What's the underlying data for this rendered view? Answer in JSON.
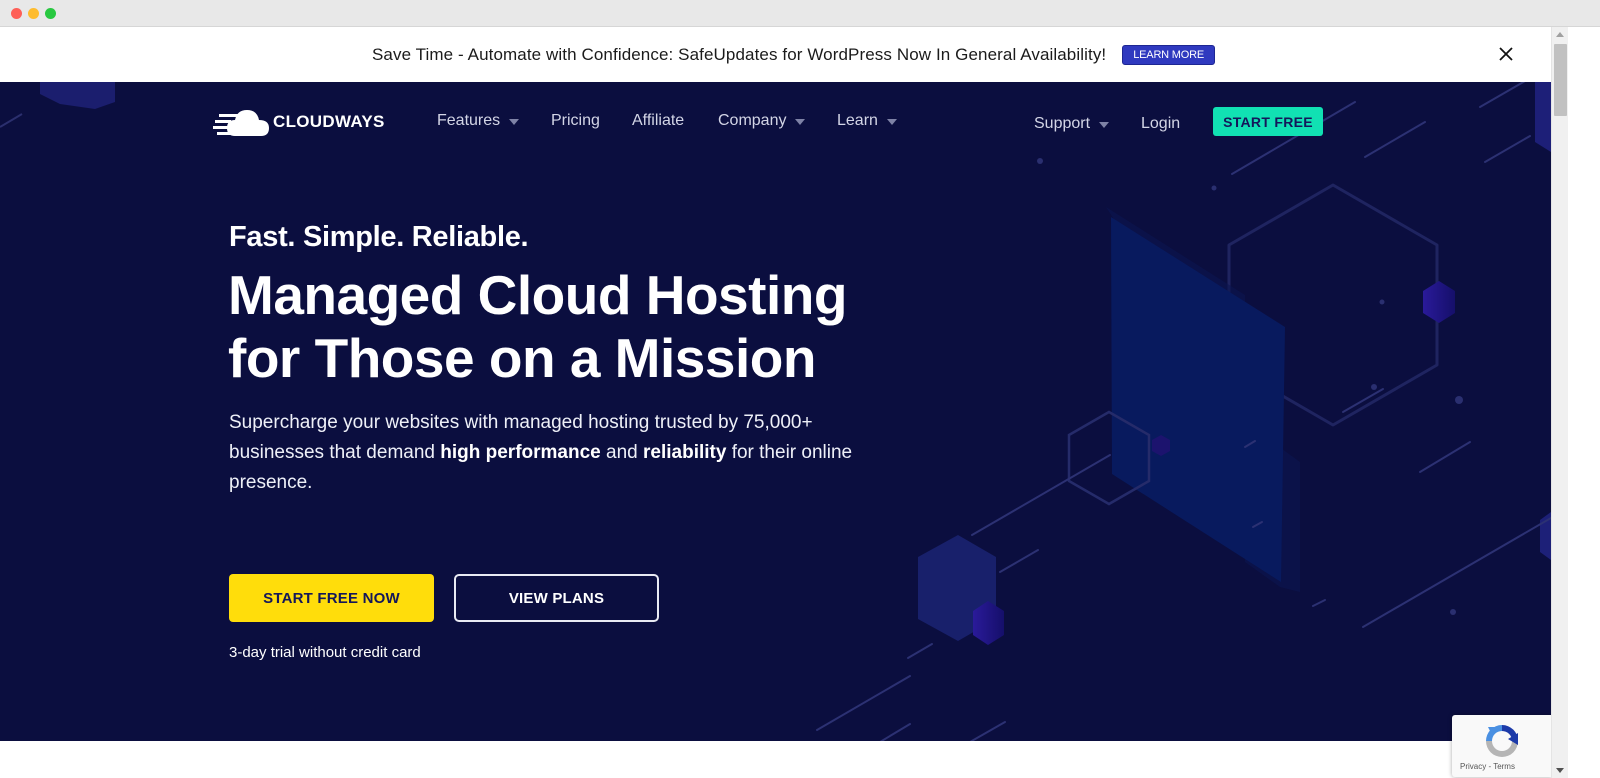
{
  "window": {
    "controls": [
      "close",
      "minimize",
      "maximize"
    ]
  },
  "announcement": {
    "text": "Save Time - Automate with Confidence: SafeUpdates for WordPress Now In General Availability!",
    "button_label": "LEARN MORE",
    "close_icon": "close-icon",
    "button_color": "#2f39bf"
  },
  "nav": {
    "logo_text": "CLOUDWAYS",
    "logo_icon": "cloud-speed-icon",
    "items": [
      {
        "label": "Features",
        "has_dropdown": true
      },
      {
        "label": "Pricing",
        "has_dropdown": false
      },
      {
        "label": "Affiliate",
        "has_dropdown": false
      },
      {
        "label": "Company",
        "has_dropdown": true
      },
      {
        "label": "Learn",
        "has_dropdown": true
      }
    ],
    "right_items": [
      {
        "label": "Support",
        "has_dropdown": true
      },
      {
        "label": "Login",
        "has_dropdown": false
      }
    ],
    "cta_label": "START FREE",
    "cta_color": "#11e1b3"
  },
  "hero": {
    "tagline": "Fast. Simple. Reliable.",
    "headline_line1": "Managed Cloud Hosting",
    "headline_line2": "for Those on a Mission",
    "subtext_part1": "Supercharge your websites with managed hosting trusted by 75,000+ businesses that demand ",
    "subtext_bold1": "high performance",
    "subtext_part2": " and ",
    "subtext_bold2": "reliability",
    "subtext_part3": " for their online presence.",
    "primary_button": "START FREE NOW",
    "secondary_button": "VIEW PLANS",
    "trial_note": "3-day trial without credit card",
    "background_color": "#0b0e3f",
    "primary_color": "#ffdd0b"
  },
  "recaptcha": {
    "links": "Privacy - Terms",
    "icon": "recaptcha-icon"
  }
}
